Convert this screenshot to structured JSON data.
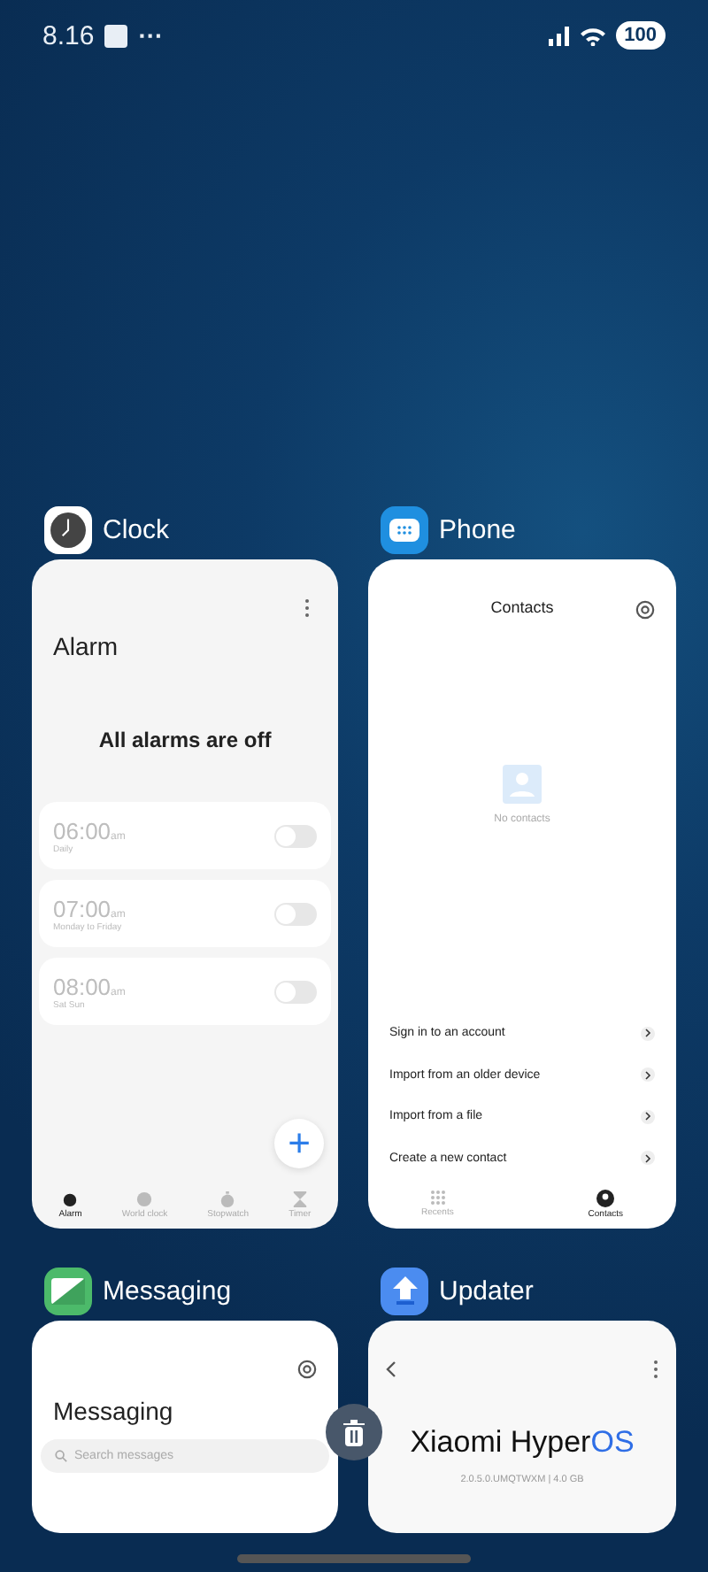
{
  "status_bar": {
    "time": "8.16",
    "more": "···",
    "battery": "100"
  },
  "apps": [
    {
      "kind": "clock",
      "name": "Clock",
      "screen": {
        "title": "Alarm",
        "empty_message": "All alarms are off",
        "alarms": [
          {
            "time": "06:00",
            "suffix": "am",
            "repeat": "Daily",
            "on": false
          },
          {
            "time": "07:00",
            "suffix": "am",
            "repeat": "Monday to Friday",
            "on": false
          },
          {
            "time": "08:00",
            "suffix": "am",
            "repeat": "Sat Sun",
            "on": false
          }
        ],
        "add_button": "+",
        "tabs": [
          {
            "label": "Alarm",
            "selected": true
          },
          {
            "label": "World clock",
            "selected": false
          },
          {
            "label": "Stopwatch",
            "selected": false
          },
          {
            "label": "Timer",
            "selected": false
          }
        ]
      }
    },
    {
      "kind": "phone",
      "name": "Phone",
      "screen": {
        "title": "Contacts",
        "empty_message": "No contacts",
        "actions": [
          "Sign in to an account",
          "Import from an older device",
          "Import from a file",
          "Create a new contact"
        ],
        "tabs": [
          {
            "label": "Recents",
            "selected": false
          },
          {
            "label": "Contacts",
            "selected": true
          }
        ]
      }
    },
    {
      "kind": "messaging",
      "name": "Messaging",
      "screen": {
        "title": "Messaging",
        "search": {
          "placeholder": "Search messages"
        }
      }
    },
    {
      "kind": "updater",
      "name": "Updater",
      "screen": {
        "title": "Xiaomi Hyper",
        "title_accent": "OS",
        "version": "2.0.5.0.UMQTWXM | 4.0 GB"
      }
    }
  ]
}
